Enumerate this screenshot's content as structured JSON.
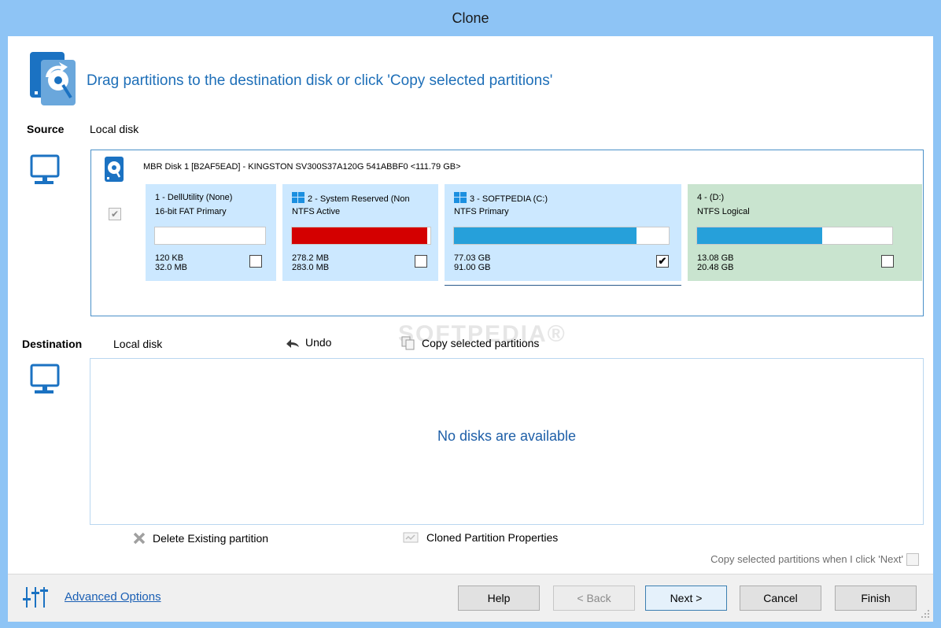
{
  "window": {
    "title": "Clone"
  },
  "header": {
    "instruction": "Drag partitions to the destination disk or click 'Copy selected partitions'"
  },
  "source": {
    "label": "Source",
    "type": "Local disk",
    "disk_title": "MBR Disk 1 [B2AF5EAD] - KINGSTON SV300S37A120G 541ABBF0  <111.79 GB>",
    "partitions": [
      {
        "name": "1 - DellUtility (None)",
        "fs": "16-bit FAT Primary",
        "used": "120 KB",
        "total": "32.0 MB",
        "checked": false,
        "fill": 0.0,
        "fill_color": "#26a0da",
        "bg": "#cce8ff",
        "win_icon": false
      },
      {
        "name": "2 - System Reserved (Non",
        "fs": "NTFS Active",
        "used": "278.2 MB",
        "total": "283.0 MB",
        "checked": false,
        "fill": 0.98,
        "fill_color": "#d40000",
        "bg": "#cce8ff",
        "win_icon": true
      },
      {
        "name": "3 - SOFTPEDIA (C:)",
        "fs": "NTFS Primary",
        "used": "77.03 GB",
        "total": "91.00 GB",
        "checked": true,
        "check_mark": "✔",
        "fill": 0.85,
        "fill_color": "#26a0da",
        "bg": "#cce8ff",
        "win_icon": true
      },
      {
        "name": "4 - (D:)",
        "fs": "NTFS Logical",
        "used": "13.08 GB",
        "total": "20.48 GB",
        "checked": false,
        "fill": 0.64,
        "fill_color": "#26a0da",
        "bg": "#c9e4cf",
        "win_icon": false
      }
    ]
  },
  "destination": {
    "label": "Destination",
    "type": "Local disk",
    "undo_label": "Undo",
    "copy_label": "Copy selected partitions",
    "empty_message": "No disks are available"
  },
  "actions": {
    "delete_label": "Delete Existing partition",
    "properties_label": "Cloned Partition Properties",
    "copy_on_next_label": "Copy selected partitions when I click 'Next'"
  },
  "footer": {
    "advanced_label": "Advanced Options",
    "buttons": {
      "help": "Help",
      "back": "< Back",
      "next": "Next >",
      "cancel": "Cancel",
      "finish": "Finish"
    }
  },
  "watermark": "SOFTPEDIA®",
  "colors": {
    "accent": "#1e6fb8",
    "title_bar": "#8ec4f5",
    "icon_blue": "#1b72c2"
  }
}
